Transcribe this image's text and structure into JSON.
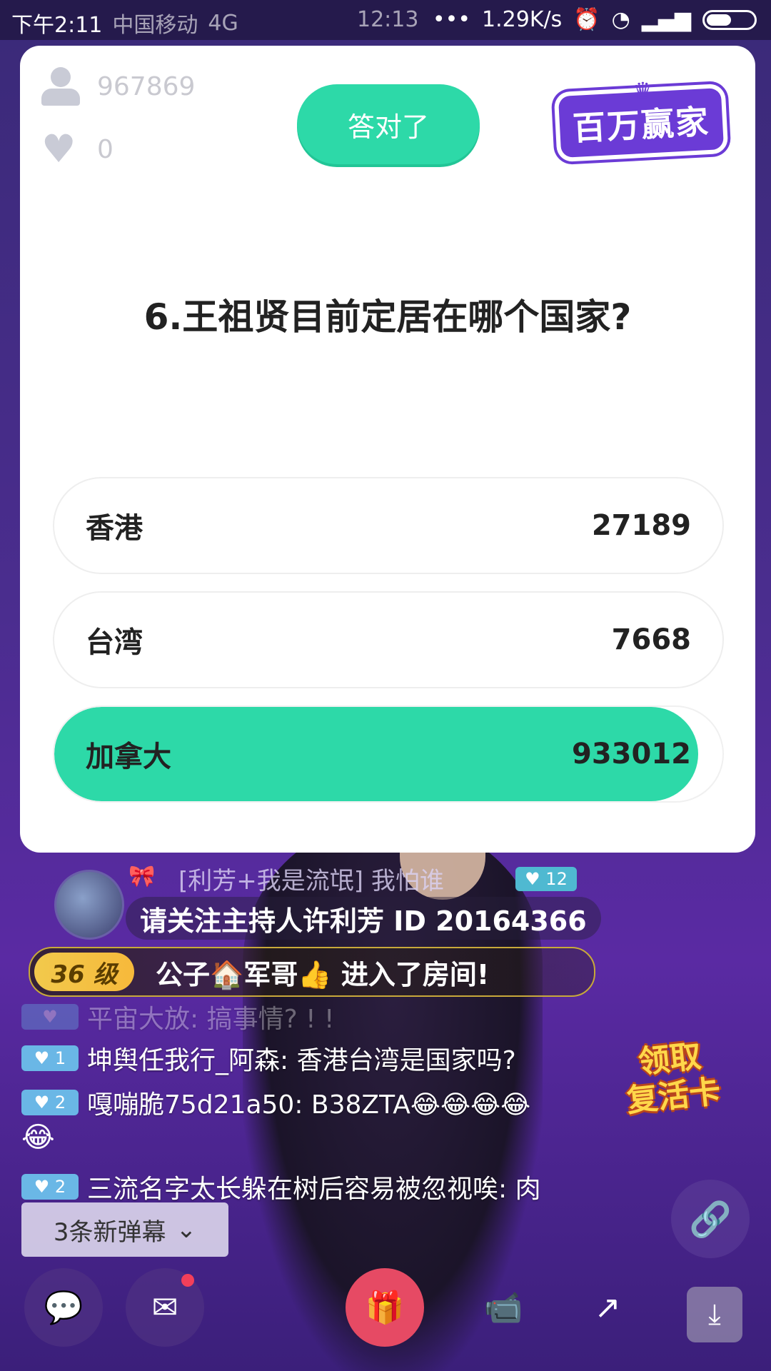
{
  "status_bar": {
    "time_left": "下午2:11",
    "carrier": "中国移动",
    "network": "4G",
    "clock": "12:13",
    "speed": "1.29K/s"
  },
  "quiz": {
    "viewers": "967869",
    "hearts": "0",
    "result_badge": "答对了",
    "logo_text": "百万赢家",
    "question": "6.王祖贤目前定居在哪个国家?",
    "options": [
      {
        "label": "香港",
        "count": "27189",
        "share": 0.028
      },
      {
        "label": "台湾",
        "count": "7668",
        "share": 0.0079
      },
      {
        "label": "加拿大",
        "count": "933012",
        "share": 0.9641
      }
    ],
    "correct_color": "#2dd9a8"
  },
  "live": {
    "host_line": "[利芳+我是流氓] 我怕谁",
    "host_level": "♥ 12",
    "follow_banner": "请关注主持人许利芳 ID 20164366",
    "enter": {
      "level": "36 级",
      "text": "公子🏠军哥👍  进入了房间!"
    },
    "messages": [
      {
        "level": "",
        "text": "平宙大放: 搞事情? ! !"
      },
      {
        "level": "♥ 1",
        "text": "坤舆任我行_阿森: 香港台湾是国家吗?"
      },
      {
        "level": "♥ 2",
        "text": "嘎嘣脆75d21a50: B38ZTA😂😂😂😂"
      },
      {
        "level": "♥ 2",
        "text": "三流名字太长躲在树后容易被忽视唉: 肉"
      }
    ],
    "emoji_line": "😂",
    "revive_card": "领取\n复活卡",
    "new_messages": "3条新弹幕"
  },
  "icons": {
    "chat": "chat-bubble-icon",
    "mail": "mail-icon",
    "gift": "gift-icon",
    "video": "video-icon",
    "share": "share-icon",
    "download": "download-icon",
    "link": "link-icon"
  }
}
